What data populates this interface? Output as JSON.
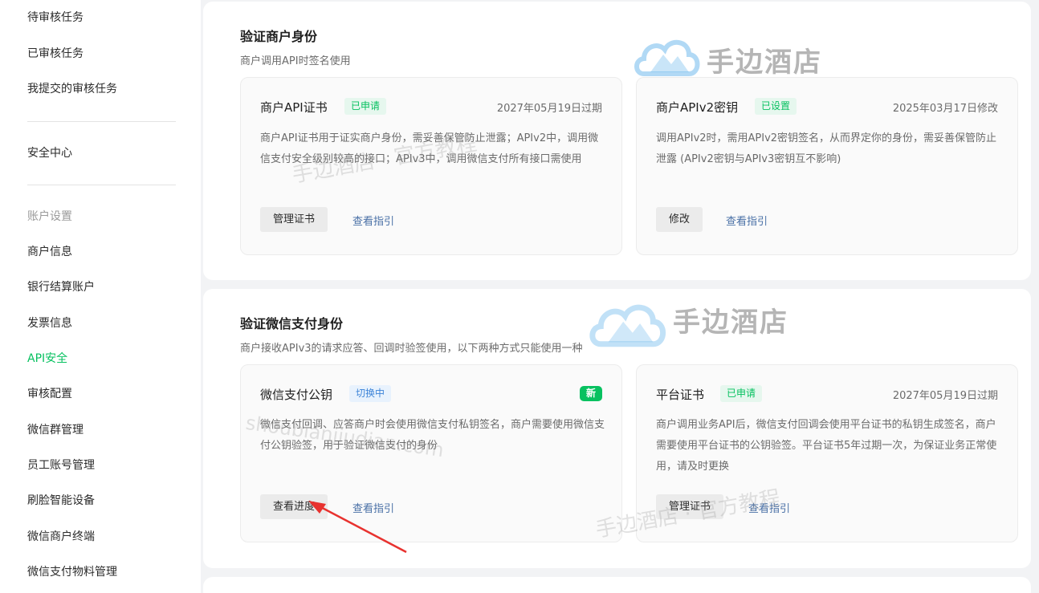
{
  "sidebar": {
    "items_top": [
      "待审核任务",
      "已审核任务",
      "我提交的审核任务"
    ],
    "security": "安全中心",
    "account_group_title": "账户设置",
    "account_items": [
      "商户信息",
      "银行结算账户",
      "发票信息",
      "API安全",
      "审核配置",
      "微信群管理",
      "员工账号管理",
      "刷脸智能设备",
      "微信商户终端",
      "微信支付物料管理"
    ]
  },
  "section1": {
    "title": "验证商户身份",
    "desc": "商户调用API时签名使用",
    "card_cert": {
      "title": "商户API证书",
      "tag": "已申请",
      "date": "2027年05月19日过期",
      "desc": "商户API证书用于证实商户身份，需妥善保管防止泄露；APIv2中，调用微信支付安全级别较高的接口；APIv3中，调用微信支付所有接口需使用",
      "button": "管理证书",
      "link": "查看指引"
    },
    "card_key": {
      "title": "商户APIv2密钥",
      "tag": "已设置",
      "date": "2025年03月17日修改",
      "desc": "调用APIv2时，需用APIv2密钥签名，从而界定你的身份，需妥善保管防止泄露 (APIv2密钥与APIv3密钥互不影响)",
      "button": "修改",
      "link": "查看指引"
    }
  },
  "section2": {
    "title": "验证微信支付身份",
    "desc": "商户接收APIv3的请求应答、回调时验签使用，以下两种方式只能使用一种",
    "card_pubkey": {
      "title": "微信支付公钥",
      "tag": "切换中",
      "badge": "新",
      "desc": "微信支付回调、应答商户时会使用微信支付私钥签名，商户需要使用微信支付公钥验签，用于验证微信支付的身份",
      "button": "查看进度",
      "link": "查看指引"
    },
    "card_platform": {
      "title": "平台证书",
      "tag": "已申请",
      "date": "2027年05月19日过期",
      "desc": "商户调用业务API后，微信支付回调会使用平台证书的私钥生成签名，商户需要使用平台证书的公钥验签。平台证书5年过期一次，为保证业务正常使用，请及时更换",
      "button": "管理证书",
      "link": "查看指引"
    }
  },
  "watermarks": {
    "brand": "手边酒店",
    "tagline": "手边酒店 · 官方教程",
    "domain": "shoubianjiudian.com"
  },
  "colors": {
    "accent_green": "#07c160",
    "link_blue": "#4970a6",
    "arrow_red": "#e8322f"
  }
}
